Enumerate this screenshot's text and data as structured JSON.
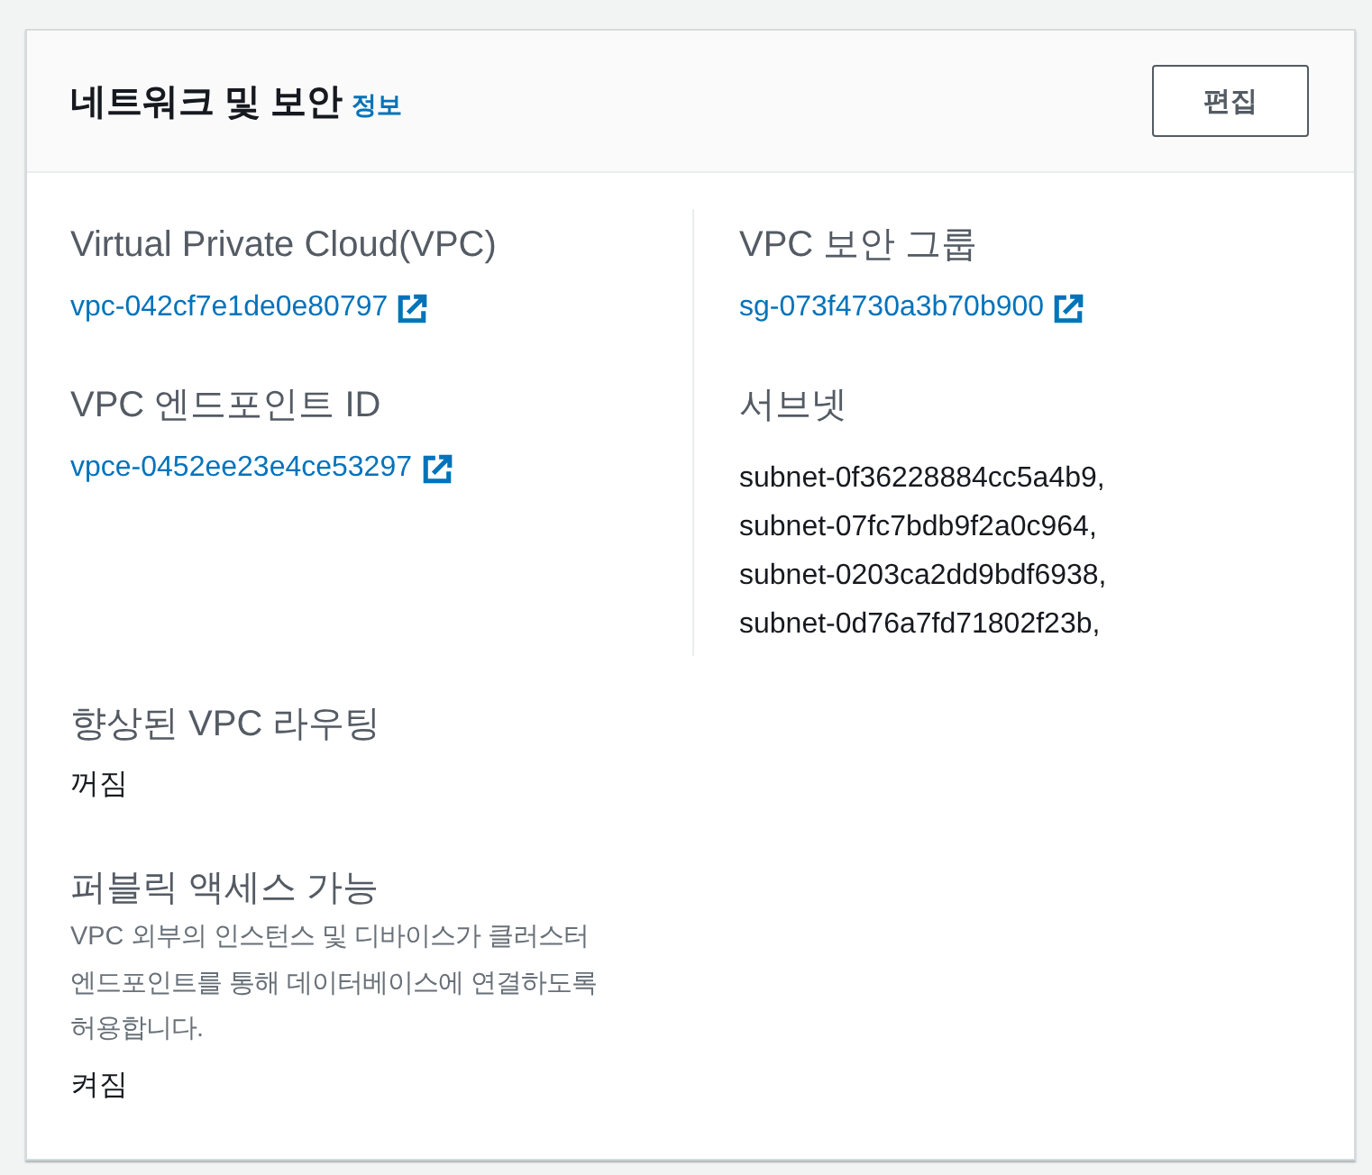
{
  "header": {
    "title": "네트워크 및 보안",
    "info_link": "정보",
    "edit_button": "편집"
  },
  "columns": [
    {
      "fields": [
        {
          "label": "Virtual Private Cloud(VPC)",
          "kind": "link",
          "value": "vpc-042cf7e1de0e80797"
        },
        {
          "label": "VPC 엔드포인트 ID",
          "kind": "link",
          "value": "vpce-0452ee23e4ce53297"
        }
      ]
    },
    {
      "fields": [
        {
          "label": "VPC 보안 그룹",
          "kind": "link",
          "value": "sg-073f4730a3b70b900"
        },
        {
          "label": "서브넷",
          "kind": "list",
          "values": [
            "subnet-0f36228884cc5a4b9,",
            "subnet-07fc7bdb9f2a0c964,",
            "subnet-0203ca2dd9bdf6938,",
            "subnet-0d76a7fd71802f23b,"
          ]
        }
      ]
    }
  ],
  "bottom_fields": [
    {
      "label": "향상된 VPC 라우팅",
      "kind": "text",
      "value": "꺼짐"
    },
    {
      "label": "퍼블릭 액세스 가능",
      "description": "VPC 외부의 인스턴스 및 디바이스가 클러스터 엔드포인트를 통해 데이터베이스에 연결하도록 허용합니다.",
      "kind": "text",
      "value": "켜짐"
    }
  ]
}
